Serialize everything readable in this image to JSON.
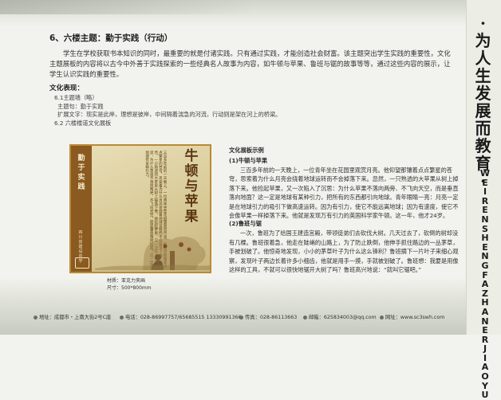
{
  "side_title": {
    "chars": [
      "·",
      "为",
      "人",
      "生",
      "发",
      "展",
      "而",
      "教",
      "育",
      "·"
    ],
    "pinyin": [
      "W",
      "E",
      "I",
      "R",
      "E",
      "N",
      "S",
      "H",
      "E",
      "N",
      "G",
      "F",
      "A",
      "Z",
      "H",
      "A",
      "N",
      "E",
      "R",
      "J",
      "I",
      "A",
      "O",
      "Y",
      "U"
    ]
  },
  "section": {
    "title": "6、六楼主题：勤于实践（行动）",
    "intro": "学生在学校获取书本知识的同时，最重要的就是付诸实践。只有通过实践，才能创造社会财富。该主题突出学生实践的重要性，文化主题展板的内容将以古今中外善于实践探索的一些经典名人故事为内容，如牛顿与苹果、鲁班与锯的故事等等，通过这些内容的展示，让学生认识实践的重要性。",
    "culture_label": "文化表现：",
    "lines": [
      "6.1主题墙（略）",
      "主题句：勤于实践",
      "扩展文字：现实是此岸，理想是彼岸，中间隔着湍急的河流，行动则是架在河上的桥梁。",
      "6.2 六楼楼道文化展板"
    ]
  },
  "board": {
    "side_title": [
      "勤",
      "于",
      "实",
      "践"
    ],
    "side_org": [
      "四",
      "川",
      "省",
      "建",
      "设",
      "中",
      "学"
    ],
    "headline": [
      "牛",
      "顿",
      "与",
      "苹",
      "果"
    ],
    "text": "三百多年前的一天晚上，一位青年坐在花园里观赏月亮。他仰望那镶着点点繁星的苍穹，思索着为什么月亮会绕着地球运转而不会掉落下来。忽然，一只熟透的大苹果从树上掉落下来。他捡起苹果，又一次陷入了沉思：为什么苹果不落向两旁、不飞向天空，而是垂直落向地面？这一定是地球有某种引力。"
  },
  "caption": {
    "material": "材质：亚克力夹画",
    "size": "尺寸：500*800mm"
  },
  "example": {
    "title": "文化展板示例",
    "story1_title": "(1)牛顿与苹果",
    "story1_text": "三百多年前的一天晚上，一位青年坐在花园里观赏月亮。他仰望那镶着点点繁星的苍穹，思索着为什么月亮会绕着地球运转而不会掉落下来。忽然，一只熟透的大苹果从树上掉落下来。他捡起苹果，又一次陷入了沉思：为什么苹果不落向两旁、不飞向天空，而是垂直落向地面？这一定是地球有某种引力，把所有的东西都引向地球。青年眼睛一亮：月亮一定是在地球引力的吸引下做高速运转。因为有引力，使它不能远离地球；因为有速度，使它不会像苹果一样掉落下来。他就是发现万有引力的英国科学家牛顿。这一年，他才24岁。",
    "story2_title": "(2)鲁班与锯",
    "story2_text": "一次，鲁班为了给国王建造宫殿，带领徒弟们去砍伐大树。几天过去了，砍倒的树却没有几棵。鲁班很着急，他走在陡峭的山路上，为了防止跌倒，他伸手抓住路边的一丛茅草，手被划破了。他惊奇地发现，小小的茅草叶子为什么这么锋利？鲁班摘下一片叶子来细心观察，发现叶子两边长着许多小细齿，他就是用手一摸，手就被划破了。鲁班想：我要是用像这样的工具，不就可以很快地锯开大树了吗？鲁班高兴地说：“就叫它锯吧。”"
  },
  "footer": {
    "address": "地址：成都市・上南大街2号C座",
    "phone": "电话：028-86997757/65685515  13330991366",
    "fax": "传真：028-86113663",
    "email": "邮箱：625834003@qq.com",
    "web": "网址：www.sc3swh.com"
  }
}
